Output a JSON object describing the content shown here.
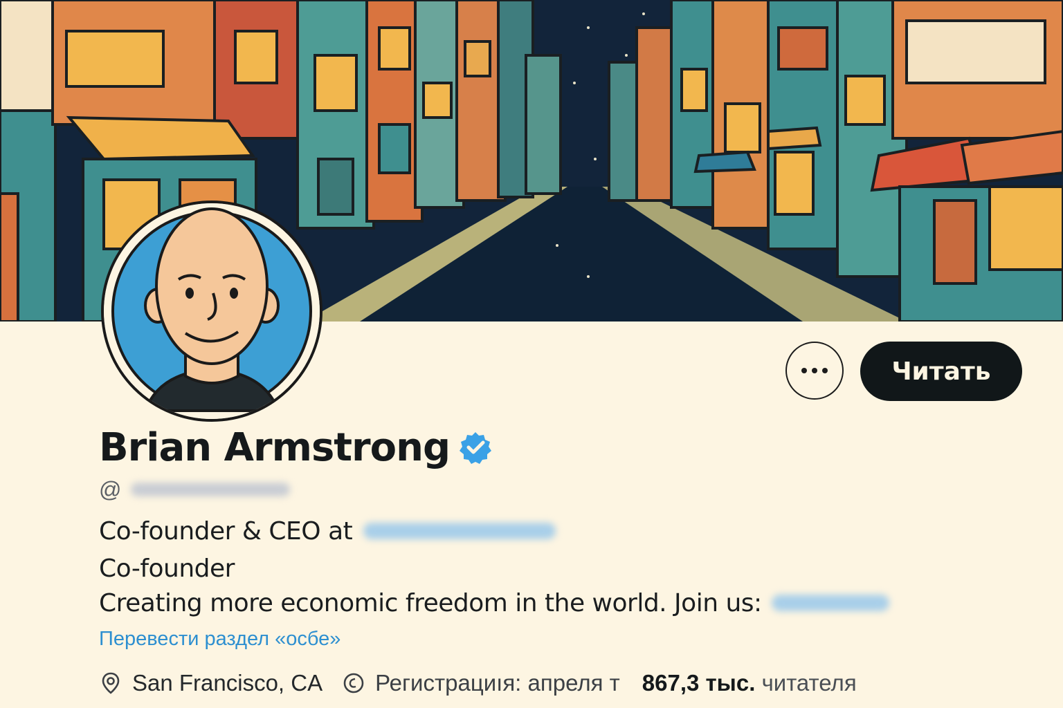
{
  "profile": {
    "name": "Brian Armstrong",
    "handle_prefix": "@",
    "bio_line1": "Co-founder & CEO at",
    "bio_line2": "Co-founder",
    "bio_line3": "Creating more economic freedom in the world. Join us:",
    "translate_label": "Перевести раздел «осбе»",
    "location": "San Francisco, CA",
    "joined": "Регистрациıя: апреля т",
    "followers_count": "867,3 тыс.",
    "followers_label": "читателя"
  },
  "actions": {
    "follow_label": "Читать"
  },
  "colors": {
    "page_bg": "#fdf5e2",
    "accent_blue": "#2d8fd0",
    "verified_blue": "#3aa1e6",
    "button_dark": "#111719"
  },
  "icons": [
    "more-icon",
    "verified-icon",
    "location-icon",
    "calendar-icon"
  ]
}
